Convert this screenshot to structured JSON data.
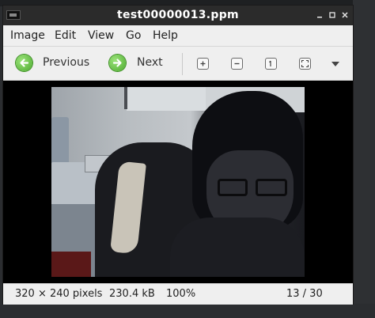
{
  "window": {
    "title": "test00000013.ppm"
  },
  "menu": {
    "items": [
      "Image",
      "Edit",
      "View",
      "Go",
      "Help"
    ]
  },
  "toolbar": {
    "previous_label": "Previous",
    "next_label": "Next",
    "tools": [
      "zoom-in-icon",
      "zoom-out-icon",
      "rotate-icon",
      "fit-icon"
    ]
  },
  "status": {
    "dimensions": "320 × 240 pixels",
    "size": "230.4 kB",
    "zoom": "100%",
    "position": "13 / 30"
  },
  "colors": {
    "titlebar": "#2b2b2b",
    "chrome": "#efefef",
    "nav_green": "#4caa2e"
  }
}
